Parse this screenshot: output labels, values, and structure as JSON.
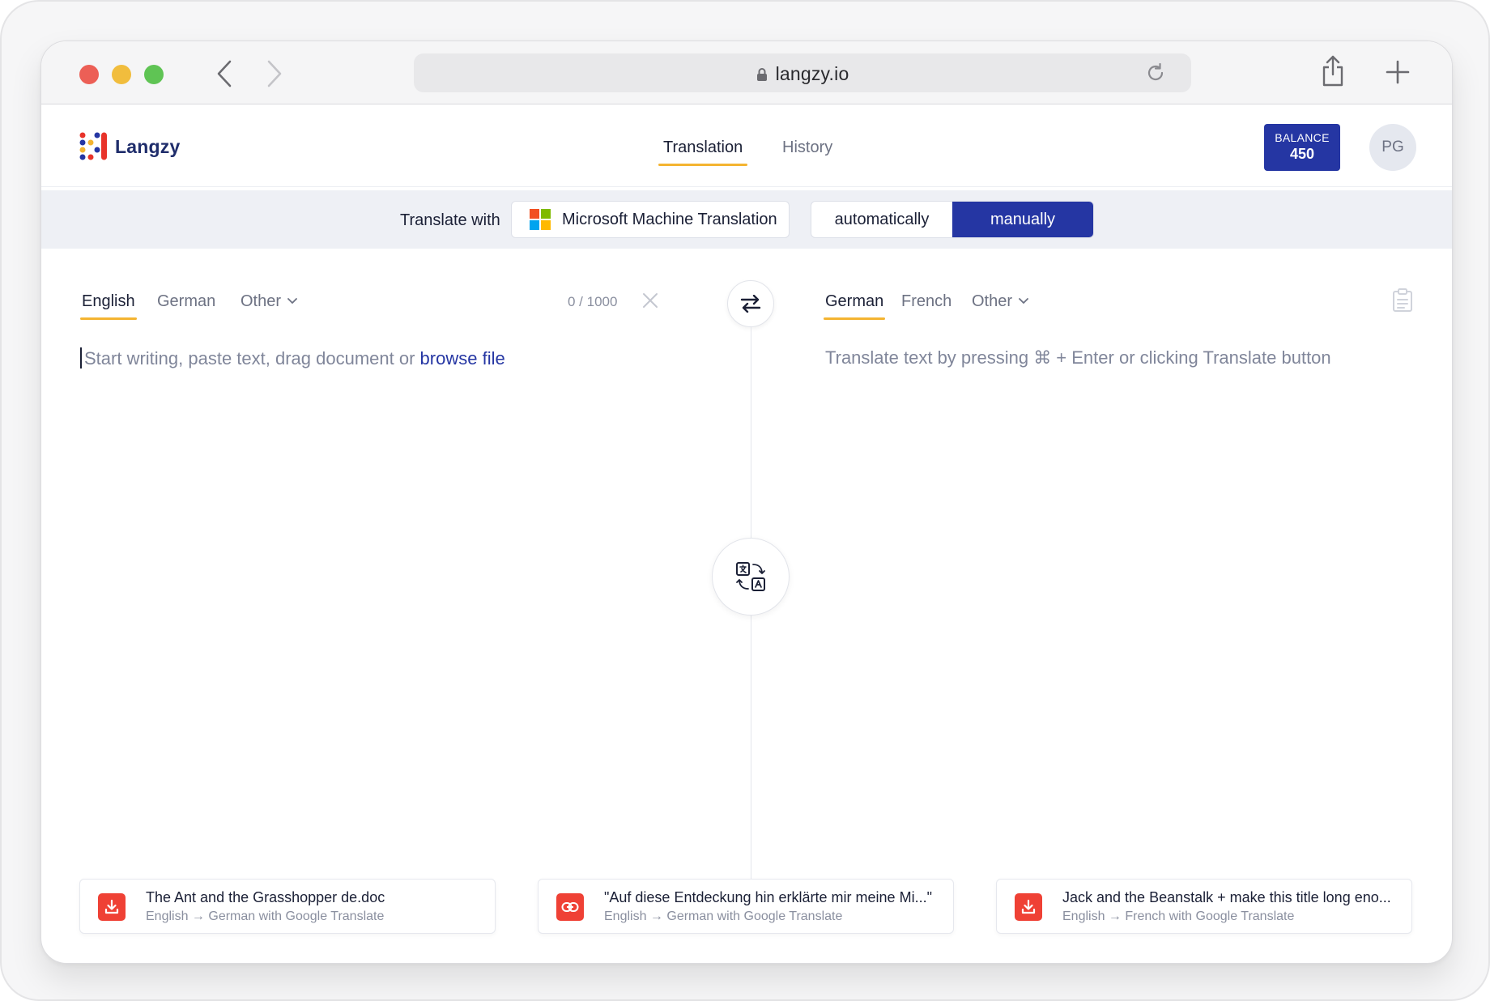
{
  "browser": {
    "url": "langzy.io"
  },
  "app": {
    "logo_text": "Langzy",
    "tabs": [
      {
        "label": "Translation",
        "active": true
      },
      {
        "label": "History",
        "active": false
      }
    ],
    "balance": {
      "label": "BALANCE",
      "value": "450"
    },
    "avatar_initials": "PG",
    "accent_color": "#2536a3",
    "highlight_color": "#f4b431"
  },
  "engine_bar": {
    "label": "Translate with",
    "engine": "Microsoft Machine Translation",
    "modes": [
      {
        "label": "automatically",
        "selected": false
      },
      {
        "label": "manually",
        "selected": true
      }
    ]
  },
  "source": {
    "languages": [
      {
        "label": "English",
        "active": true
      },
      {
        "label": "German",
        "active": false
      },
      {
        "label": "Other",
        "active": false
      }
    ],
    "counter": "0 / 1000",
    "placeholder": "Start writing, paste text, drag document or",
    "browse_link": "browse file"
  },
  "target": {
    "languages": [
      {
        "label": "German",
        "active": true
      },
      {
        "label": "French",
        "active": false
      },
      {
        "label": "Other",
        "active": false
      }
    ],
    "placeholder": "Translate text by pressing ⌘ + Enter or clicking Translate button"
  },
  "recent": [
    {
      "icon": "download-icon",
      "title": "The Ant and the Grasshopper de.doc",
      "subtitle": "English → German with Google Translate"
    },
    {
      "icon": "link-icon",
      "title": "\"Auf diese Entdeckung hin erklärte mir meine Mi...\"",
      "subtitle": "English → German with Google Translate"
    },
    {
      "icon": "download-icon",
      "title": "Jack and the Beanstalk + make this title long eno...",
      "subtitle": "English → French with Google Translate"
    }
  ]
}
